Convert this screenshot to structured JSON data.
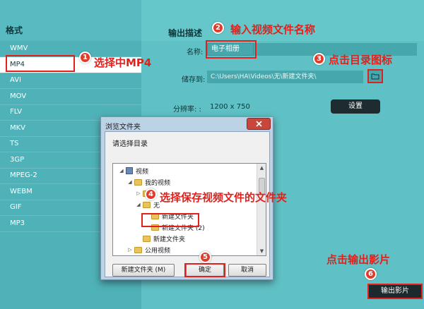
{
  "sidebar": {
    "title": "格式",
    "formats": [
      "WMV",
      "MP4",
      "AVI",
      "MOV",
      "FLV",
      "MKV",
      "TS",
      "3GP",
      "MPEG-2",
      "WEBM",
      "GIF",
      "MP3"
    ],
    "selected": "MP4"
  },
  "main": {
    "section_title": "输出描述",
    "name_label": "名称:",
    "name_value": "电子相册",
    "save_label": "储存到:",
    "save_path": "C:\\Users\\HA\\Videos\\无\\新建文件夹\\",
    "resolution_label": "分辨率: :",
    "resolution_value": "1200 x 750",
    "settings_button": "设置",
    "export_button": "输出影片"
  },
  "dialog": {
    "title": "浏览文件夹",
    "prompt": "请选择目录",
    "tree": [
      {
        "label": "视频",
        "level": 0,
        "icon": "library",
        "arrow": "expanded"
      },
      {
        "label": "我的视频",
        "level": 1,
        "icon": "folder",
        "arrow": "expanded"
      },
      {
        "label": "",
        "level": 2,
        "icon": "folder",
        "arrow": "collapsed"
      },
      {
        "label": "无",
        "level": 2,
        "icon": "folder",
        "arrow": "expanded"
      },
      {
        "label": "新建文件夹",
        "level": 3,
        "icon": "folder",
        "arrow": "none"
      },
      {
        "label": "新建文件夹 (2)",
        "level": 3,
        "icon": "folder",
        "arrow": "none"
      },
      {
        "label": "新建文件夹",
        "level": 2,
        "icon": "folder",
        "arrow": "none"
      },
      {
        "label": "公用视频",
        "level": 1,
        "icon": "folder",
        "arrow": "collapsed"
      }
    ],
    "new_folder_button": "新建文件夹 (M)",
    "ok_button": "确定",
    "cancel_button": "取消"
  },
  "annotations": {
    "step1": {
      "num": "1",
      "text": "选择中MP4"
    },
    "step2": {
      "num": "2",
      "text": "输入视频文件名称"
    },
    "step3": {
      "num": "3",
      "text": "点击目录图标"
    },
    "step4": {
      "num": "4",
      "text": "选择保存视频文件的文件夹"
    },
    "step5": {
      "num": "5"
    },
    "step6": {
      "num": "6",
      "text": "点击输出影片"
    }
  },
  "colors": {
    "sidebar_bg": "#4fb2b8",
    "main_bg": "#5fc1c5",
    "annotation_red": "#e0211c",
    "dark_button": "#1e2c30"
  }
}
